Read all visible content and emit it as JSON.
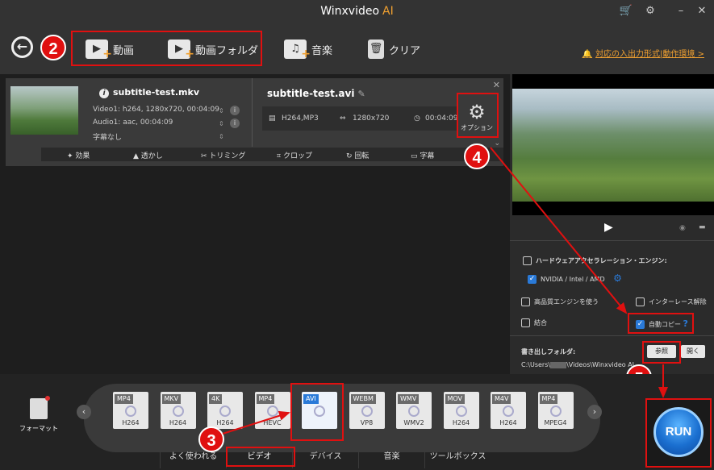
{
  "app": {
    "title": "Winxvideo",
    "title_suffix": "AI"
  },
  "titlebar": {
    "cart_icon": "cart-icon",
    "settings_icon": "gear-icon",
    "minimize": "–",
    "close": "✕"
  },
  "toolbar": {
    "add_video": "動画",
    "add_folder": "動画フォルダ",
    "music": "音楽",
    "clear": "クリア",
    "notice": "対応の入出力形式|動作環境 >"
  },
  "steps": {
    "s2": "2",
    "s3": "3",
    "s4": "4",
    "s5": "5"
  },
  "item": {
    "source_name": "subtitle-test.mkv",
    "video_info": "Video1: h264, 1280x720, 00:04:09",
    "audio_info": "Audio1: aac, 00:04:09",
    "subtitle_info": "字幕なし",
    "output_name": "subtitle-test.avi",
    "out_codec": "H264,MP3",
    "out_resolution": "1280x720",
    "out_duration": "00:04:09",
    "option_label": "オプション",
    "edit": {
      "effect": "効果",
      "watermark": "透かし",
      "trim": "トリミング",
      "crop": "クロップ",
      "rotate": "回転",
      "subtitle": "字幕"
    }
  },
  "settings": {
    "hw_accel": "ハードウェアアクセラレーション・エンジン:",
    "gpu": "NVIDIA / Intel / AMD",
    "gpu_checked": true,
    "hq_engine": "高品質エンジンを使う",
    "deinterlace": "インターレース解除",
    "merge": "結合",
    "auto_copy": "自動コピー",
    "auto_copy_checked": true,
    "help": "?",
    "output_folder_label": "書き出しフォルダ:",
    "browse": "参照",
    "open": "開く",
    "path_prefix": "C:\\Users\\",
    "path_suffix": "\\Videos\\Winxvideo AI"
  },
  "formats": {
    "label": "フォーマット",
    "cards": [
      {
        "tag": "MP4",
        "sub": "H264"
      },
      {
        "tag": "MKV",
        "sub": "H264"
      },
      {
        "tag": "4K",
        "sub": "H264"
      },
      {
        "tag": "MP4",
        "sub": "HEVC"
      },
      {
        "tag": "AVI",
        "sub": ""
      },
      {
        "tag": "WEBM",
        "sub": "VP8"
      },
      {
        "tag": "WMV",
        "sub": "WMV2"
      },
      {
        "tag": "MOV",
        "sub": "H264"
      },
      {
        "tag": "M4V",
        "sub": "H264"
      },
      {
        "tag": "MP4",
        "sub": "MPEG4"
      }
    ],
    "selected_index": 4,
    "tabs": [
      "よく使われる",
      "ビデオ",
      "デバイス",
      "音楽",
      "ツールボックス"
    ],
    "active_tab": "ビデオ"
  },
  "run": {
    "label": "RUN"
  },
  "colors": {
    "accent": "#f0a030",
    "highlight": "#e01010",
    "select_blue": "#2a7ad8"
  }
}
